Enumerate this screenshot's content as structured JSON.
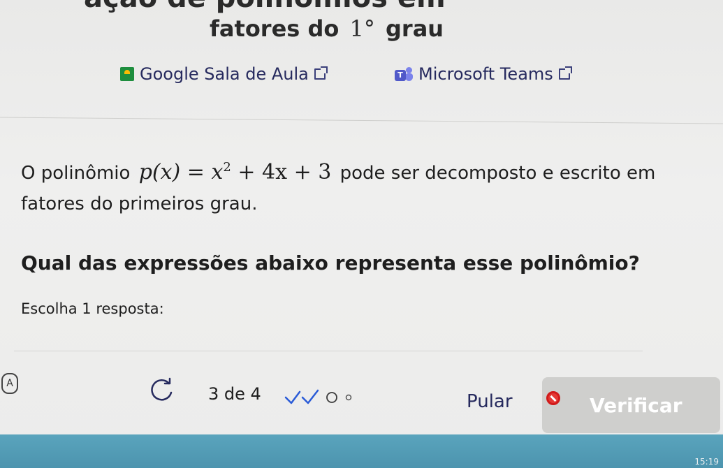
{
  "header": {
    "title_line1": "ação de polinômios em",
    "title_prefix": "fatores do",
    "title_number": "1°",
    "title_suffix": "grau"
  },
  "share": {
    "google_classroom_label": "Google Sala de Aula",
    "microsoft_teams_label": "Microsoft Teams",
    "teams_icon_letter": "T"
  },
  "question": {
    "statement_start": "O polinômio",
    "formula": {
      "lhs": "p(x) = x",
      "exponent": "2",
      "rhs": "+ 4x + 3"
    },
    "statement_end": "pode ser decomposto e escrito em fatores do primeiros grau.",
    "prompt": "Qual das expressões abaixo representa esse polinômio?",
    "instruction": "Escolha 1 resposta:"
  },
  "toolbar": {
    "accessibility_icon_letter": "A",
    "progress_text": "3 de 4",
    "progress": {
      "completed": 2,
      "total": 4
    },
    "skip_label": "Pular",
    "verify_label": "Verificar"
  },
  "taskbar": {
    "clock": "15:19"
  },
  "colors": {
    "link": "#262a5e",
    "check": "#2a5bd7",
    "verify_disabled_bg": "#cfcfcd",
    "taskbar": "#4c94ae",
    "block_red": "#e53935"
  }
}
